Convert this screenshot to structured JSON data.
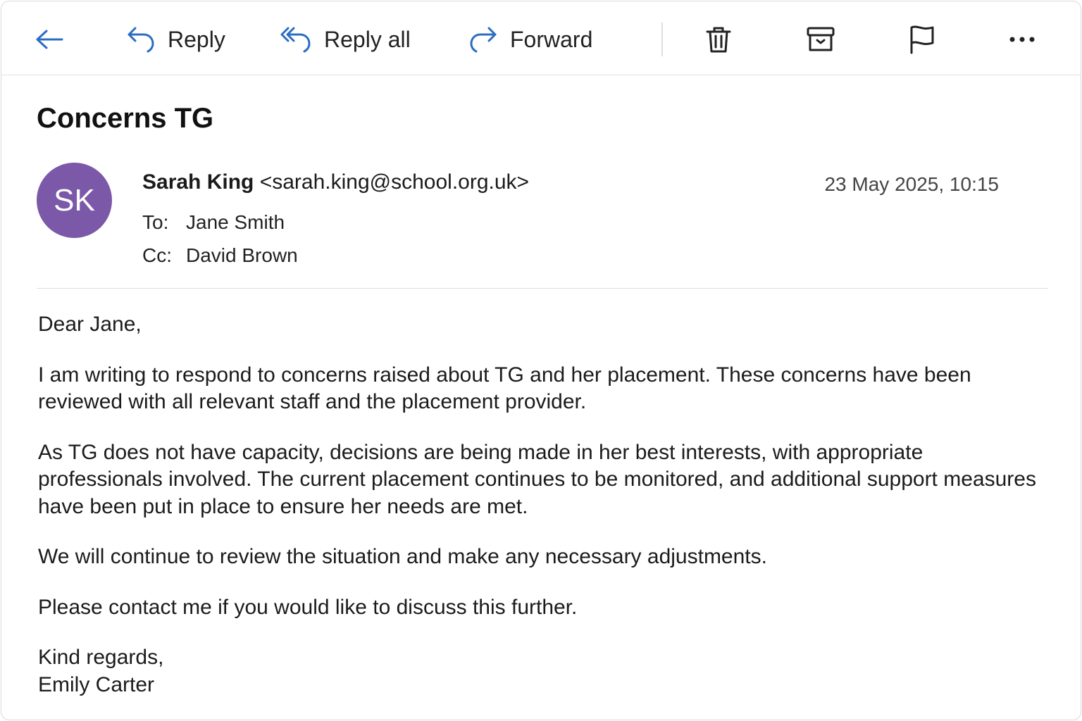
{
  "toolbar": {
    "back_icon": "arrow-left-icon",
    "reply_label": "Reply",
    "reply_all_label": "Reply all",
    "forward_label": "Forward",
    "icons": [
      "trash-icon",
      "archive-icon",
      "flag-icon",
      "more-icon"
    ],
    "accent_color": "#2b6cc4"
  },
  "message": {
    "subject": "Concerns TG",
    "avatar_initials": "SK",
    "avatar_color": "#7b58a8",
    "sender_name": "Sarah King",
    "sender_email": "<sarah.king@school.org.uk>",
    "date": "23 May 2025, 10:15",
    "to_label": "To:",
    "to": "Jane Smith",
    "cc_label": "Cc:",
    "cc": "David Brown",
    "greeting": "Dear Jane,",
    "paragraph1": "I am writing to respond to concerns raised about TG and her placement. These concerns have been reviewed with all relevant staff and the placement provider.",
    "paragraph2": "As TG does not have capacity, decisions are being made in her best interests, with appropriate professionals involved. The current placement continues to be monitored, and additional support measures have been put in place to ensure her needs are met.",
    "paragraph3": "We will continue to review the situation and make any necessary adjustments.",
    "paragraph4": "Please contact me if you would like to discuss this further.",
    "signoff": "Kind regards,",
    "signature": "Emily Carter"
  }
}
